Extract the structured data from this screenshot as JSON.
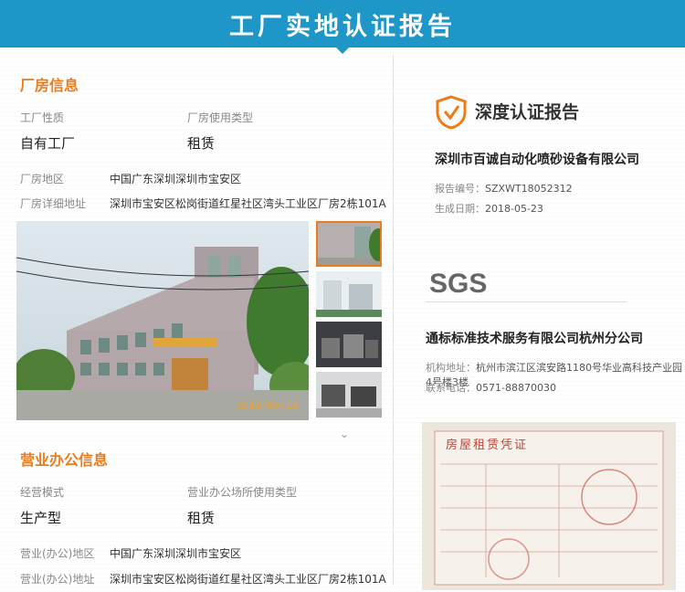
{
  "banner": {
    "title": "工厂实地认证报告"
  },
  "factory": {
    "section_title": "厂房信息",
    "nature_label": "工厂性质",
    "nature_value": "自有工厂",
    "usage_label": "厂房使用类型",
    "usage_value": "租赁",
    "region_label": "厂房地区",
    "region_value": "中国广东深圳深圳市宝安区",
    "address_label": "厂房详细地址",
    "address_value": "深圳市宝安区松岗街道红星社区湾头工业区厂房2栋101A",
    "photo_date": "2018/05/23"
  },
  "office": {
    "section_title": "营业办公信息",
    "mode_label": "经营模式",
    "mode_value": "生产型",
    "usage_label": "营业办公场所使用类型",
    "usage_value": "租赁",
    "region_label": "营业(办公)地区",
    "region_value": "中国广东深圳深圳市宝安区",
    "address_label": "营业(办公)地址",
    "address_value": "深圳市宝安区松岗街道红星社区湾头工业区厂房2栋101A"
  },
  "report": {
    "title": "深度认证报告",
    "company": "深圳市百诚自动化喷砂设备有限公司",
    "report_no_label": "报告编号：",
    "report_no": "SZXWT18052312",
    "date_label": "生成日期：",
    "date": "2018-05-23"
  },
  "agency": {
    "logo_text": "SGS",
    "company": "通标标准技术服务有限公司杭州分公司",
    "address_label": "机构地址：",
    "address": "杭州市滨江区滨安路1180号华业高科技产业园4号楼3楼",
    "phone_label": "联系电话：",
    "phone": "0571-88870030"
  },
  "certificate": {
    "heading": "房屋租赁凭证"
  },
  "colors": {
    "banner": "#1e96c8",
    "accent": "#ee7b1a"
  }
}
